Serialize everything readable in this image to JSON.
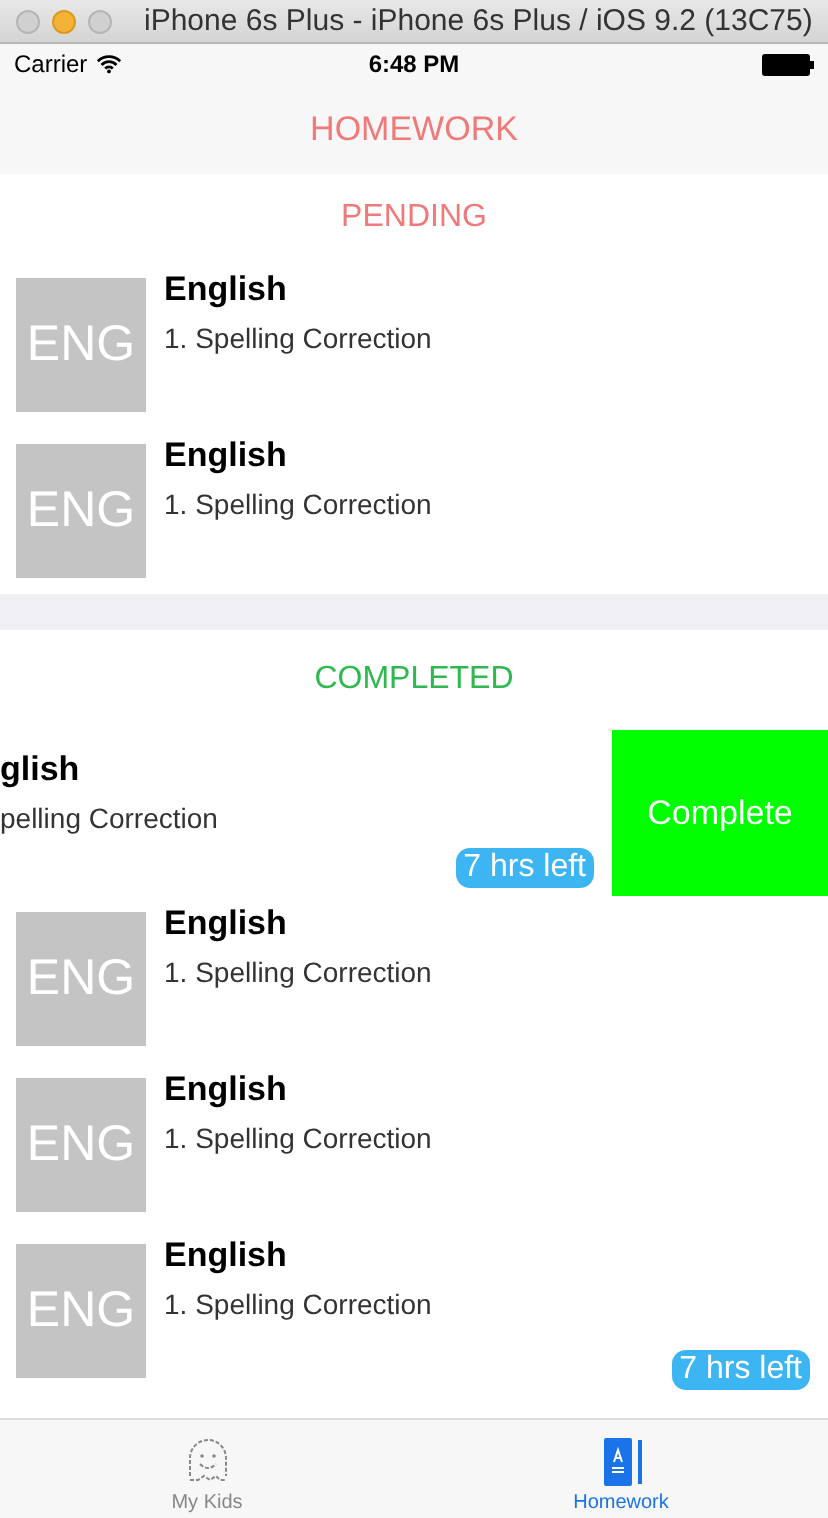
{
  "window": {
    "title": "iPhone 6s Plus - iPhone 6s Plus / iOS 9.2 (13C75)"
  },
  "status_bar": {
    "carrier": "Carrier",
    "time": "6:48 PM"
  },
  "nav": {
    "title": "HOMEWORK"
  },
  "sections": [
    {
      "title": "PENDING",
      "color": "#f07a7a",
      "rows": [
        {
          "kind": "normal",
          "thumbnail": "ENG",
          "title": "English",
          "subtitle": "1. Spelling Correction"
        },
        {
          "kind": "normal",
          "thumbnail": "ENG",
          "title": "English",
          "subtitle": "1. Spelling Correction"
        }
      ]
    },
    {
      "title": "COMPLETED",
      "color": "#2fb84f",
      "rows": [
        {
          "kind": "swiped",
          "title": "glish",
          "subtitle": "pelling Correction",
          "badge": "7 hrs left",
          "action": "Complete"
        },
        {
          "kind": "normal",
          "thumbnail": "ENG",
          "title": "English",
          "subtitle": "1. Spelling Correction"
        },
        {
          "kind": "normal",
          "thumbnail": "ENG",
          "title": "English",
          "subtitle": "1. Spelling Correction"
        },
        {
          "kind": "normal",
          "thumbnail": "ENG",
          "title": "English",
          "subtitle": "1. Spelling Correction",
          "badge": "7 hrs left"
        }
      ]
    }
  ],
  "tabs": [
    {
      "label": "My Kids",
      "kind": "kid",
      "selected": false
    },
    {
      "label": "Homework",
      "kind": "book",
      "selected": true
    }
  ]
}
